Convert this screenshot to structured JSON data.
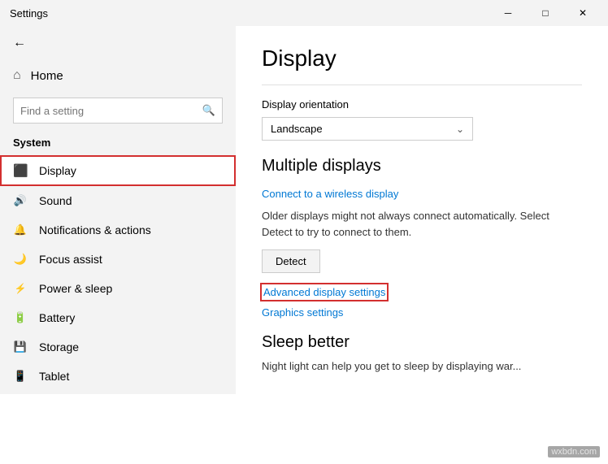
{
  "titleBar": {
    "title": "Settings",
    "minimizeLabel": "─",
    "maximizeLabel": "□",
    "closeLabel": "✕"
  },
  "sidebar": {
    "homeLabel": "Home",
    "searchPlaceholder": "Find a setting",
    "sectionLabel": "System",
    "items": [
      {
        "id": "display",
        "label": "Display",
        "icon": "🖥",
        "active": true
      },
      {
        "id": "sound",
        "label": "Sound",
        "icon": "🔊",
        "active": false
      },
      {
        "id": "notifications",
        "label": "Notifications & actions",
        "icon": "🔔",
        "active": false
      },
      {
        "id": "focus",
        "label": "Focus assist",
        "icon": "🌙",
        "active": false
      },
      {
        "id": "power",
        "label": "Power & sleep",
        "icon": "⚡",
        "active": false
      },
      {
        "id": "battery",
        "label": "Battery",
        "icon": "🔋",
        "active": false
      },
      {
        "id": "storage",
        "label": "Storage",
        "icon": "💾",
        "active": false
      },
      {
        "id": "tablet",
        "label": "Tablet",
        "icon": "📱",
        "active": false
      }
    ]
  },
  "content": {
    "title": "Display",
    "orientationLabel": "Display orientation",
    "orientationValue": "Landscape",
    "multipleDisplaysTitle": "Multiple displays",
    "wirelessLink": "Connect to a wireless display",
    "descriptionText": "Older displays might not always connect automatically. Select Detect to try to connect to them.",
    "detectButton": "Detect",
    "advancedLink": "Advanced display settings",
    "graphicsLink": "Graphics settings",
    "sleepTitle": "Sleep better",
    "sleepDescription": "Night light can help you get to sleep by displaying war..."
  },
  "watermark": "wxbdn.com"
}
